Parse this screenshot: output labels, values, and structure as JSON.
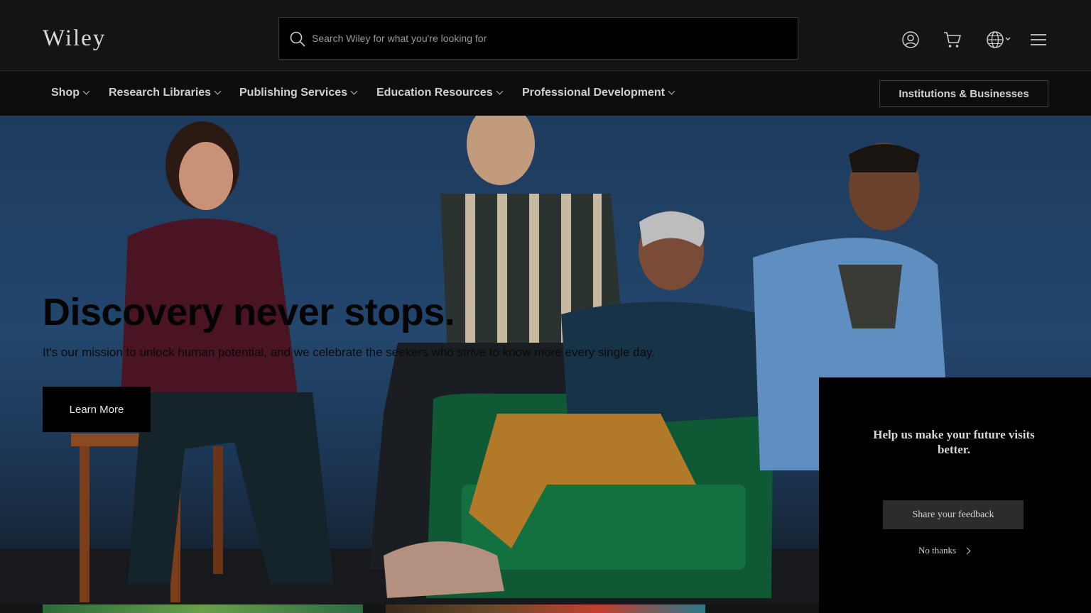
{
  "header": {
    "logo_text": "Wiley",
    "search_placeholder": "Search Wiley for what you're looking for",
    "icons": [
      "search-icon",
      "account-icon",
      "cart-icon",
      "globe-icon",
      "menu-icon"
    ]
  },
  "nav": {
    "items": [
      {
        "label": "Shop"
      },
      {
        "label": "Research Libraries"
      },
      {
        "label": "Publishing Services"
      },
      {
        "label": "Education Resources"
      },
      {
        "label": "Professional Development"
      }
    ],
    "institutions_button": "Institutions & Businesses"
  },
  "hero": {
    "title": "Discovery never stops.",
    "subtitle": "It's our mission to unlock human potential, and we celebrate the seekers who strive to know more every single day.",
    "cta_label": "Learn More"
  },
  "feedback": {
    "title": "Help us make your future visits better.",
    "share_button": "Share your feedback",
    "dismiss_label": "No thanks"
  },
  "colors": {
    "background": "#141414",
    "hero_blue": "#23466c",
    "panel": "#000000"
  }
}
